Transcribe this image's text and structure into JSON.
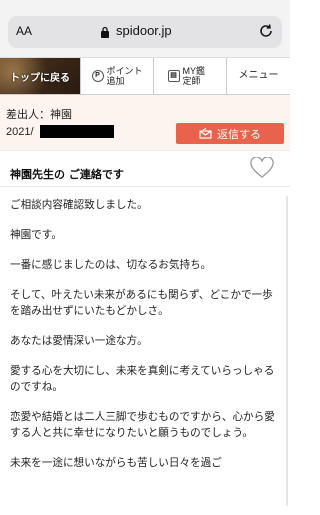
{
  "browser": {
    "text_size_label": "AA",
    "url": "spidoor.jp"
  },
  "site_nav": {
    "back_to_top": "トップに戻る",
    "points_label": "ポイント追加",
    "my_fortune_teller": "MY鑑定師",
    "menu": "メニュー"
  },
  "message": {
    "sender_label": "差出人：",
    "sender_name": "神園",
    "date_prefix": "2021/",
    "reply_label": "返信する",
    "subject": "神園先生の ご連絡です",
    "paragraphs": [
      "ご相談内容確認致しました。",
      "神園です。",
      "一番に感じましたのは、切なるお気持ち。",
      "そして、叶えたい未来があるにも関らず、どこかで一歩を踏み出せずにいたもどかしさ。",
      "あなたは愛情深い一途な方。",
      "愛する心を大切にし、未来を真剣に考えていらっしゃるのですね。",
      "恋愛や結婚とは二人三脚で歩むものですから、心から愛する人と共に幸せになりたいと願うものでしょう。",
      "未来を一途に想いながらも苦しい日々を過ご"
    ]
  }
}
